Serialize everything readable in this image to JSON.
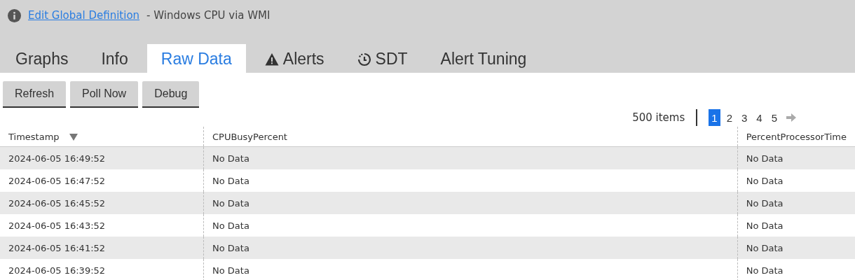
{
  "header": {
    "link": "Edit Global Definition",
    "title": " - Windows CPU via WMI"
  },
  "tabs": [
    {
      "label": "Graphs",
      "kind": "plain",
      "selected": false
    },
    {
      "label": "Info",
      "kind": "plain",
      "selected": false
    },
    {
      "label": "Raw Data",
      "kind": "plain",
      "selected": true
    },
    {
      "label": "Alerts",
      "kind": "warning",
      "selected": false
    },
    {
      "label": "SDT",
      "kind": "clock",
      "selected": false
    },
    {
      "label": "Alert Tuning",
      "kind": "plain",
      "selected": false
    }
  ],
  "buttons": [
    "Refresh",
    "Poll Now",
    "Debug"
  ],
  "pagination": {
    "count": "500 items",
    "pages": [
      {
        "label": "1",
        "selected": true
      },
      {
        "label": "2",
        "selected": false
      },
      {
        "label": "3",
        "selected": false
      },
      {
        "label": "4",
        "selected": false
      },
      {
        "label": "5",
        "selected": false
      }
    ]
  },
  "table": {
    "columns": [
      {
        "label": "Timestamp",
        "sorted": true
      },
      {
        "label": "CPUBusyPercent",
        "sorted": false
      },
      {
        "label": "PercentProcessorTime",
        "sorted": false
      }
    ],
    "rows": [
      [
        "2024-06-05 16:49:52",
        "No Data",
        "No Data"
      ],
      [
        "2024-06-05 16:47:52",
        "No Data",
        "No Data"
      ],
      [
        "2024-06-05 16:45:52",
        "No Data",
        "No Data"
      ],
      [
        "2024-06-05 16:43:52",
        "No Data",
        "No Data"
      ],
      [
        "2024-06-05 16:41:52",
        "No Data",
        "No Data"
      ],
      [
        "2024-06-05 16:39:52",
        "No Data",
        "No Data"
      ]
    ]
  }
}
